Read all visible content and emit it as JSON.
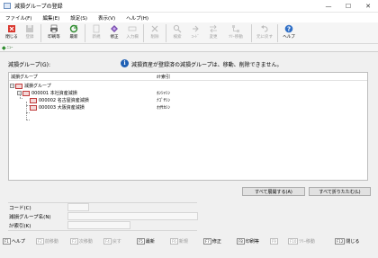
{
  "window": {
    "title": "減損グループの登録",
    "controls": {
      "minimize": "—",
      "maximize": "☐",
      "close": "✕"
    }
  },
  "menu": [
    "ファイル(F)",
    "編集(E)",
    "設定(S)",
    "表示(V)",
    "ヘルプ(H)"
  ],
  "toolbar": [
    {
      "label": "閉じる",
      "icon": "close-door-icon",
      "enabled": true
    },
    {
      "label": "登録",
      "icon": "save-icon",
      "enabled": false
    },
    {
      "label": "印刷等",
      "icon": "printer-icon",
      "enabled": true
    },
    {
      "label": "最新",
      "icon": "refresh-icon",
      "enabled": true
    },
    {
      "label": "新規",
      "icon": "new-icon",
      "enabled": false
    },
    {
      "label": "修正",
      "icon": "edit-icon",
      "enabled": true
    },
    {
      "label": "入力欄",
      "icon": "input-field-icon",
      "enabled": false
    },
    {
      "label": "削除",
      "icon": "delete-icon",
      "enabled": false
    },
    {
      "label": "検索",
      "icon": "search-icon",
      "enabled": false
    },
    {
      "label": "ｺｰﾄﾞ",
      "icon": "code-icon",
      "enabled": false
    },
    {
      "label": "変更",
      "icon": "change-icon",
      "enabled": false
    },
    {
      "label": "ﾂﾘｰ移動",
      "icon": "tree-move-icon",
      "enabled": false
    },
    {
      "label": "元に戻す",
      "icon": "undo-icon",
      "enabled": false
    },
    {
      "label": "ヘルプ",
      "icon": "help-icon",
      "enabled": true
    }
  ],
  "status": {
    "icon": "pin-icon",
    "text": "ﾆｭｰ"
  },
  "group_label": "減損グループ(G):",
  "info_message": "減損資産が登録済の減損グループは、移動、削除できません。",
  "tree": {
    "headers": {
      "name": "減損グループ",
      "kana": "ｶﾅ索引"
    },
    "root": "減損グループ",
    "nodes": [
      {
        "code": "000001",
        "name": "本社資産減損",
        "kana": "ﾎﾝｼｬｼﾝ"
      },
      {
        "code": "000002",
        "name": "名古屋資産減損",
        "kana": "ﾅｺﾞﾔｼﾝ"
      },
      {
        "code": "000003",
        "name": "大阪資産減損",
        "kana": "ｵｵｻｶｼﾝ"
      }
    ]
  },
  "buttons": {
    "expand_all": "すべて展開する(A)",
    "collapse_all": "すべて折りたたむ(L)"
  },
  "detail": {
    "code_label": "コード(C)",
    "name_label": "減損グループ名(N)",
    "kana_label": "ｶﾅ索引(K)"
  },
  "fkeys": [
    {
      "key": "F1",
      "label": "ヘルプ",
      "enabled": true
    },
    {
      "key": "F2",
      "label": "前移動",
      "enabled": false
    },
    {
      "key": "F3",
      "label": "次移動",
      "enabled": false
    },
    {
      "key": "F4",
      "label": "戻す",
      "enabled": false
    },
    {
      "key": "F5",
      "label": "最新",
      "enabled": true
    },
    {
      "key": "F6",
      "label": "新規",
      "enabled": false
    },
    {
      "key": "F7",
      "label": "修正",
      "enabled": true
    },
    {
      "key": "F8",
      "label": "印刷等",
      "enabled": true
    },
    {
      "key": "F9",
      "label": "",
      "enabled": false
    },
    {
      "key": "F10",
      "label": "ﾂﾘｰ移動",
      "enabled": false
    },
    {
      "key": "F12",
      "label": "閉じる",
      "enabled": true
    }
  ]
}
